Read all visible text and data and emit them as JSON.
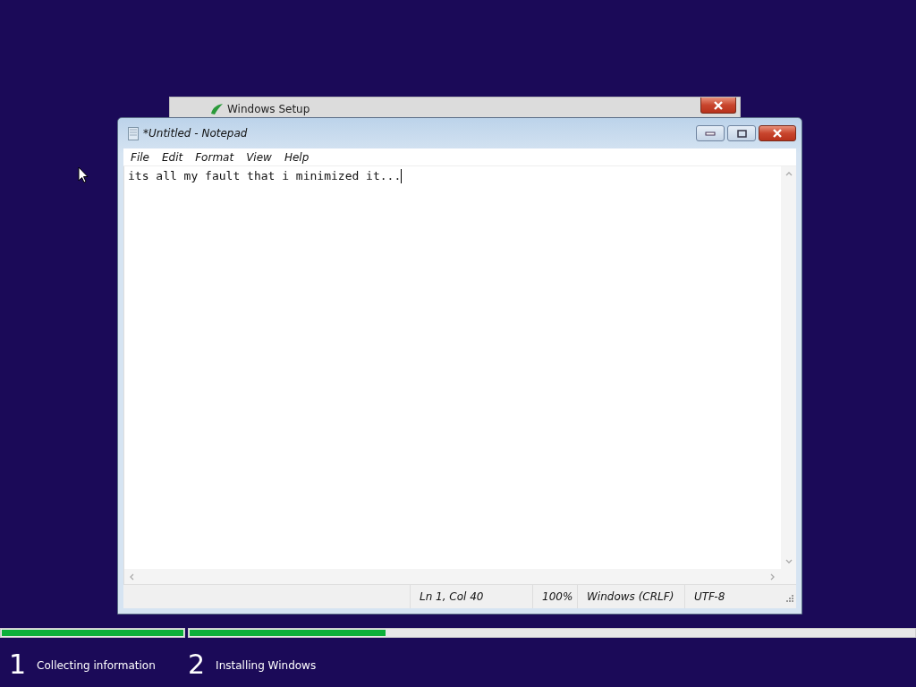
{
  "background_window": {
    "title": "Windows Setup"
  },
  "notepad": {
    "title": "*Untitled - Notepad",
    "menu": [
      "File",
      "Edit",
      "Format",
      "View",
      "Help"
    ],
    "text": "its all my fault that i minimized it...",
    "status_bar": [
      "Ln 1, Col 40",
      "100%",
      "Windows (CRLF)",
      "UTF-8"
    ]
  },
  "steps": [
    {
      "number": "1",
      "label": "Collecting information",
      "level": 1
    },
    {
      "number": "2",
      "label": "Installing Windows",
      "level": 0.27
    }
  ]
}
